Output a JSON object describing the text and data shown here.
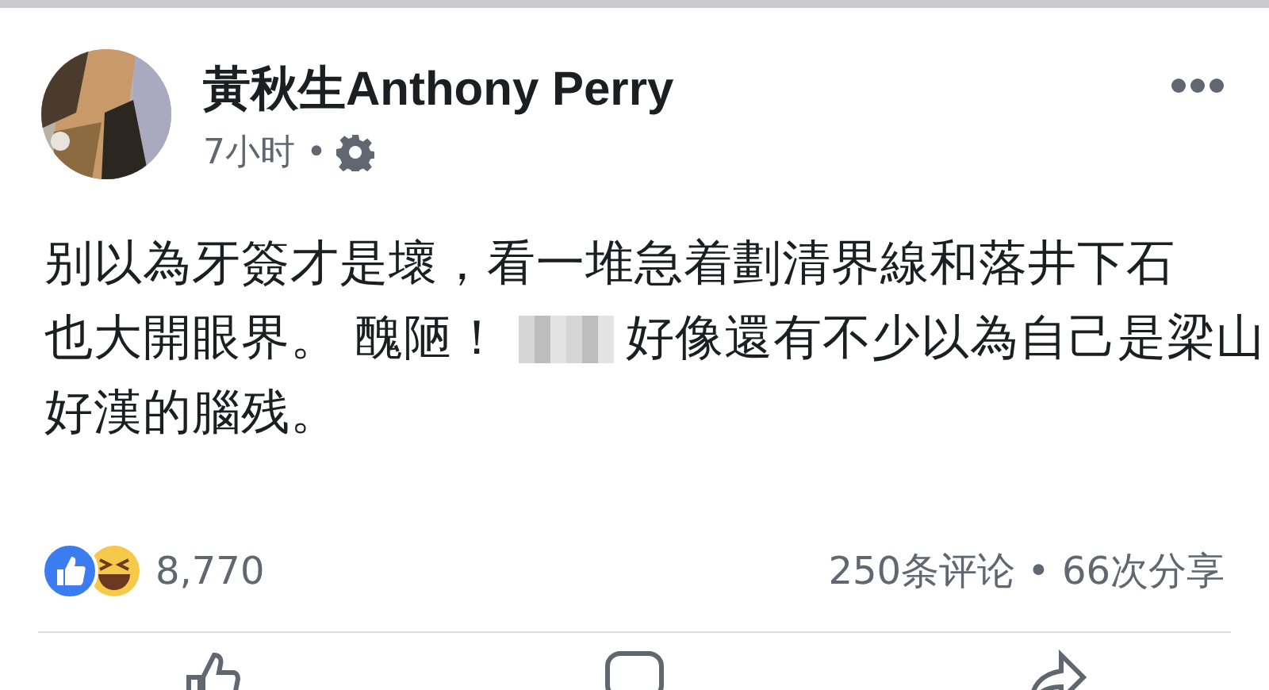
{
  "post": {
    "author": "黃秋生Anthony Perry",
    "time": "7小时 •",
    "body_lines": [
      [
        {
          "kind": "text",
          "text": "别以為牙簽才是壞，看一堆急着劃清界線和落井下石"
        }
      ],
      [
        {
          "kind": "text",
          "text": "也大開眼界。 醜陋！"
        },
        {
          "kind": "redacted"
        },
        {
          "kind": "text",
          "text": "好像還有不少以為自己是梁山"
        }
      ],
      [
        {
          "kind": "text",
          "text": "好漢的腦残。"
        }
      ]
    ],
    "reaction_count": "8,770",
    "engagement": "250条评论 • 66次分享"
  }
}
